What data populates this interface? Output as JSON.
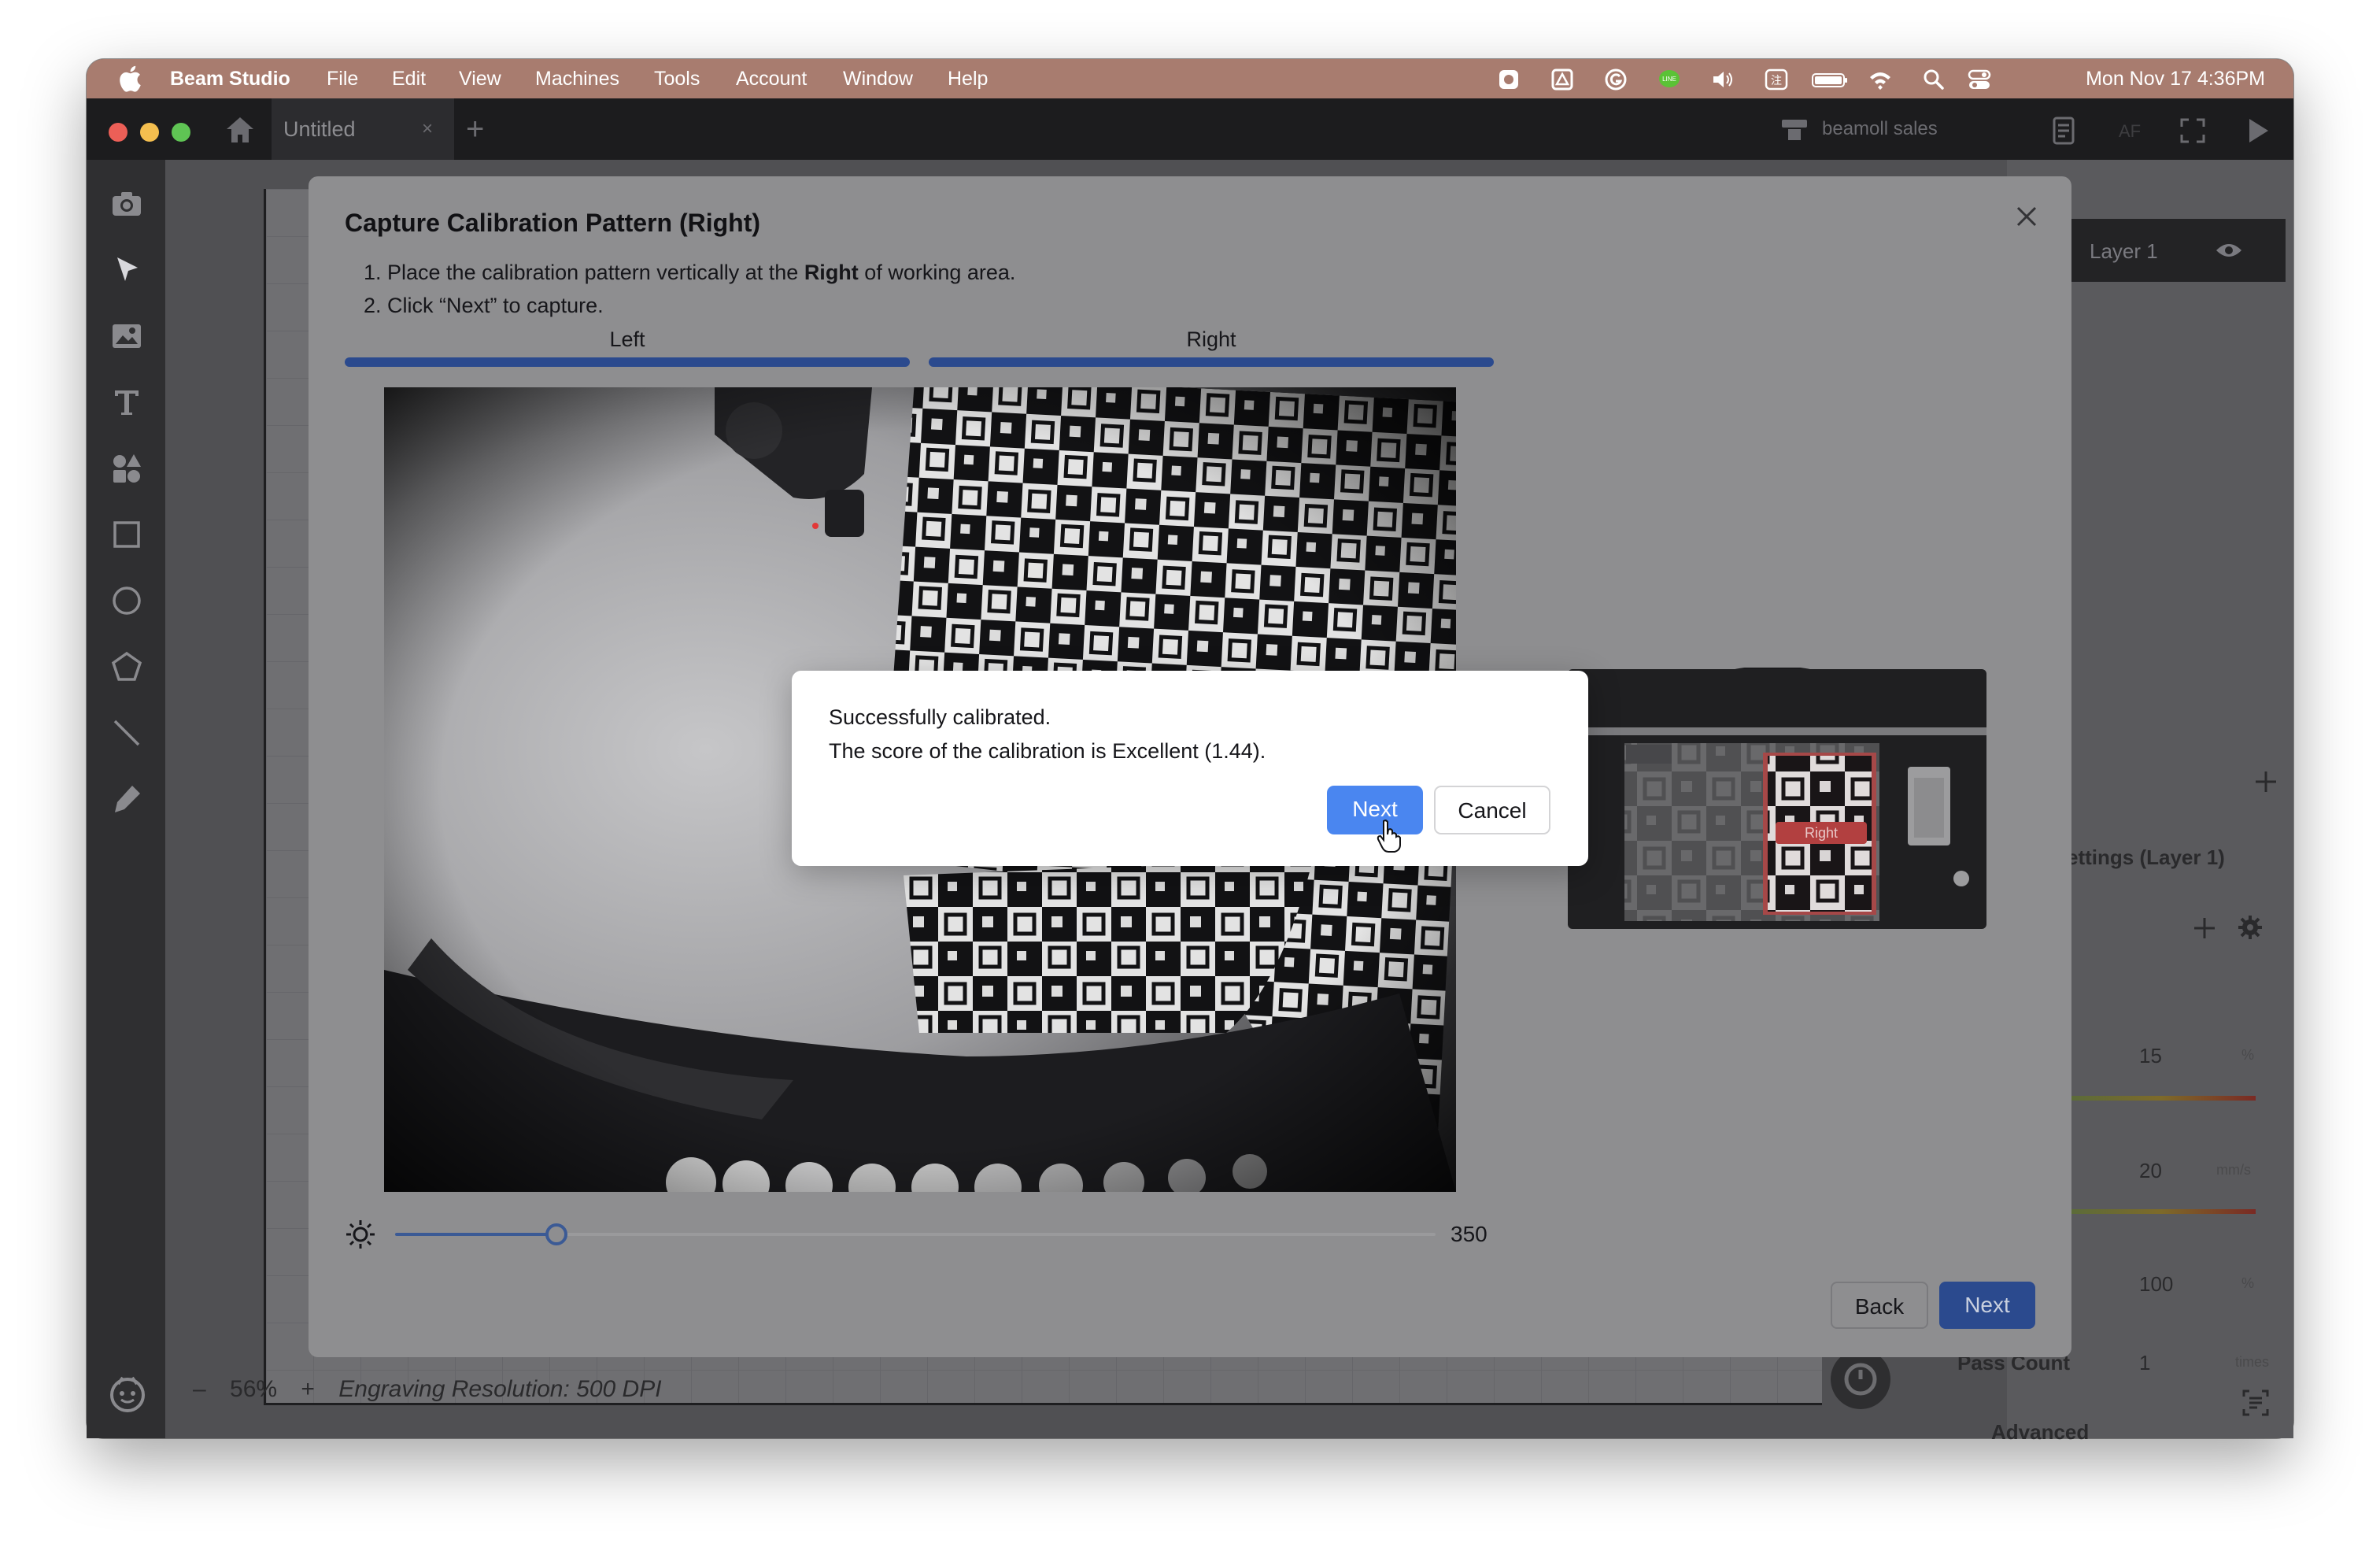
{
  "menubar": {
    "app_name": "Beam Studio",
    "items": [
      "File",
      "Edit",
      "View",
      "Machines",
      "Tools",
      "Account",
      "Window",
      "Help"
    ],
    "clock": "Mon Nov 17  4:36PM",
    "status_icons": [
      "screen-record-icon",
      "drive-icon",
      "grammarly-icon",
      "line-icon",
      "volume-icon",
      "input-method-icon",
      "battery-icon",
      "wifi-icon",
      "spotlight-icon",
      "control-center-icon"
    ]
  },
  "window": {
    "tab_title": "Untitled",
    "tab_close": "×",
    "tab_add": "+",
    "user_label": "beamoll sales"
  },
  "canvas": {
    "zoom": "56%",
    "zoom_minus": "–",
    "zoom_plus": "+",
    "engraving_resolution": "Engraving Resolution: 500 DPI"
  },
  "right_panel": {
    "layer_name": "Layer 1",
    "settings_title": "ettings (Layer 1)",
    "power_value": "15",
    "power_unit": "%",
    "speed_value": "20",
    "speed_unit": "mm/s",
    "z_value": "100",
    "z_unit": "%",
    "pass_count_label": "Pass Count",
    "pass_count_value": "1",
    "pass_count_unit": "times",
    "advanced_label": "Advanced"
  },
  "calibration_modal": {
    "title": "Capture Calibration Pattern (Right)",
    "step1_prefix": "1. Place the calibration pattern vertically at the ",
    "step1_bold": "Right",
    "step1_suffix": " of working area.",
    "step2": "2. Click “Next” to capture.",
    "progress_left_label": "Left",
    "progress_right_label": "Right",
    "brightness_value": "350",
    "brightness_fraction": 0.155,
    "back_label": "Back",
    "next_label": "Next",
    "illustration_label": "Right"
  },
  "result_dialog": {
    "line1": "Successfully calibrated.",
    "line2": "The score of the calibration is Excellent (1.44).",
    "next_label": "Next",
    "cancel_label": "Cancel"
  },
  "colors": {
    "menubar": "#a87c6f",
    "accent_blue": "#4a86f0",
    "progress_blue": "#2b4a8e"
  }
}
